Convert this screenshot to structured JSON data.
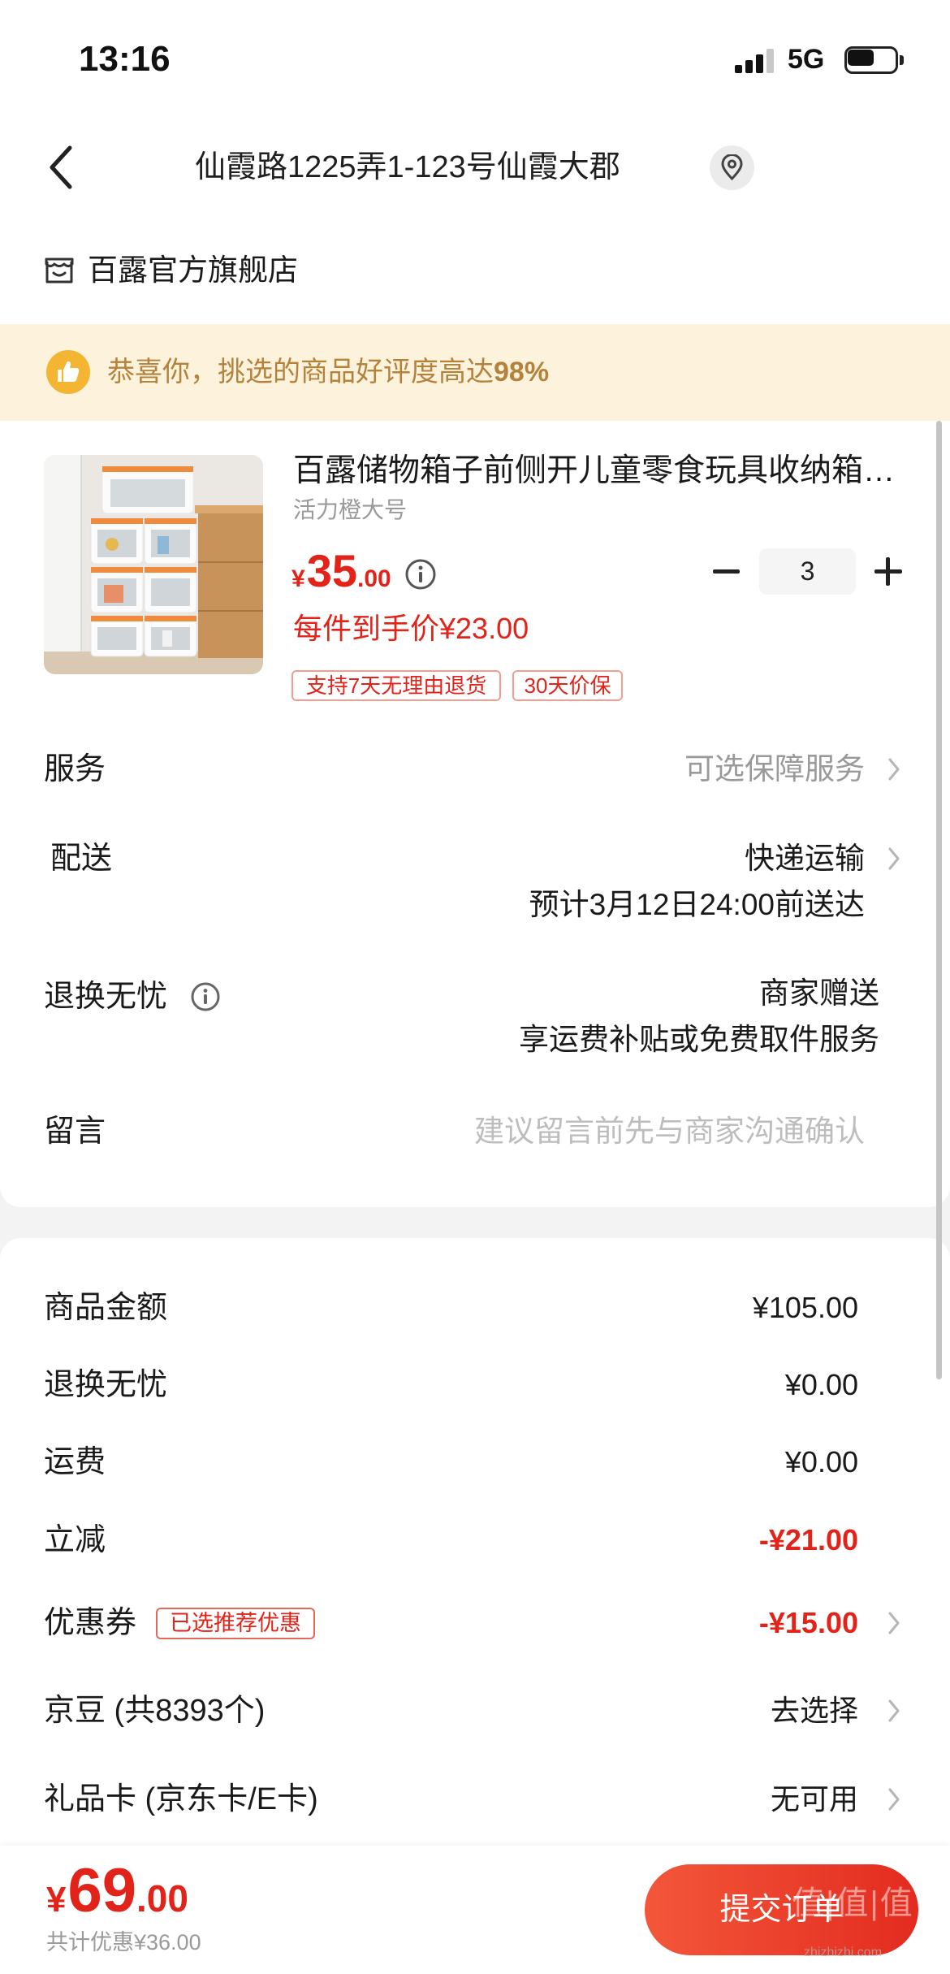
{
  "status_bar": {
    "time": "13:16",
    "network": "5G",
    "signal_bars": 3,
    "signal_max": 4,
    "battery_level": 0.62
  },
  "nav": {
    "address": "仙霞路1225弄1-123号仙霞大郡"
  },
  "store": {
    "name": "百露官方旗舰店"
  },
  "banner": {
    "text": "恭喜你，挑选的商品好评度高达",
    "rating": "98%"
  },
  "product": {
    "title": "百露储物箱子前侧开儿童零食玩具收纳箱…",
    "variant": "活力橙大号",
    "price": {
      "currency": "¥",
      "integer": "35",
      "decimal": ".00"
    },
    "unit_price_label": "每件到手价¥23.00",
    "quantity": "3",
    "tags": [
      "支持7天无理由退货",
      "30天价保"
    ]
  },
  "service": {
    "label": "服务",
    "value": "可选保障服务"
  },
  "delivery": {
    "label": "配送",
    "method": "快递运输",
    "eta": "预计3月12日24:00前送达"
  },
  "returns": {
    "label": "退换无忧",
    "value": "商家赠送",
    "detail": "享运费补贴或免费取件服务"
  },
  "message": {
    "label": "留言",
    "placeholder": "建议留言前先与商家沟通确认"
  },
  "summary": {
    "rows": [
      {
        "label": "商品金额",
        "value": "¥105.00"
      },
      {
        "label": "退换无忧",
        "value": "¥0.00"
      },
      {
        "label": "运费",
        "value": "¥0.00"
      },
      {
        "label": "立减",
        "value": "-¥21.00"
      },
      {
        "label": "优惠券",
        "tag": "已选推荐优惠",
        "value": "-¥15.00"
      },
      {
        "label": "京豆 (共8393个)",
        "value": "去选择"
      },
      {
        "label": "礼品卡 (京东卡/E卡)",
        "value": "无可用"
      }
    ]
  },
  "footer": {
    "total": {
      "currency": "¥",
      "integer": "69",
      "decimal": ".00"
    },
    "savings": "共计优惠¥36.00",
    "submit_label": "提交订单"
  },
  "watermark": {
    "mark": "值|值|值",
    "site": "zhizhizhi.com"
  },
  "icons": {
    "back": "chevron-left-icon",
    "location": "location-pin-icon",
    "store": "store-icon",
    "banner": "thumbs-up-icon",
    "info": "info-icon",
    "row_arrow": "chevron-right-icon",
    "minus": "minus-icon",
    "plus": "plus-icon"
  },
  "colors": {
    "accent_red": "#e2231a",
    "banner_bg": "#fdf3dc",
    "banner_text": "#b5823c",
    "thumb_badge": "#f4b533",
    "submit_gradient": [
      "#f3573a",
      "#e32b1f"
    ],
    "muted_text": "#9a9a9a"
  }
}
